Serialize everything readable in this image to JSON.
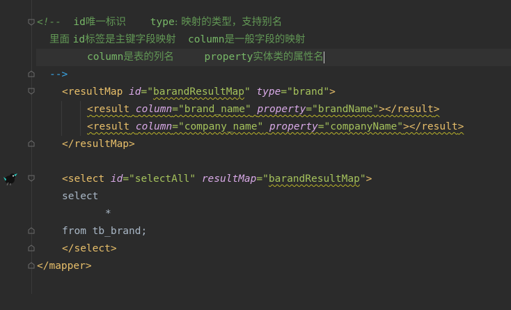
{
  "editor": {
    "lines": [
      {
        "parts": [
          "<!--",
          "id",
          "唯一标识",
          "type",
          ": ",
          "映射的类型，支持别名"
        ]
      },
      {
        "parts": [
          "里面 ",
          "id",
          "标签是主键字段映射",
          "column",
          "是一般字段的映射"
        ]
      },
      {
        "parts": [
          "column",
          "是表的列名",
          "property",
          "实体类的属性名"
        ]
      },
      {
        "parts": [
          "-->"
        ]
      },
      {
        "parts": [
          "<",
          "resultMap",
          "id",
          "=",
          "\"",
          "barandResultMap",
          "\"",
          "type",
          "=\"brand\"",
          ">"
        ]
      },
      {
        "parts": [
          "<",
          "result",
          "column",
          "=\"brand_name\"",
          "property",
          "=\"brandName\"",
          "></",
          "result",
          ">"
        ]
      },
      {
        "parts": [
          "<",
          "result",
          "column",
          "=\"company_name\"",
          "property",
          "=\"companyName\"",
          "></",
          "result",
          ">"
        ]
      },
      {
        "parts": [
          "</",
          "resultMap",
          ">"
        ]
      },
      {
        "parts": [
          "<",
          "select",
          "id",
          "=\"selectAll\"",
          "resultMap",
          "=\"",
          "barandResultMap",
          "\"",
          ">"
        ]
      },
      {
        "parts": [
          "select"
        ]
      },
      {
        "parts": [
          "*"
        ]
      },
      {
        "parts": [
          "from tb_brand;"
        ]
      },
      {
        "parts": [
          "</",
          "select",
          ">"
        ]
      },
      {
        "parts": [
          "</",
          "mapper",
          ">"
        ]
      }
    ]
  },
  "colors": {
    "background": "#2b2b2b",
    "current_line": "#323232",
    "tag": "#e8bf6a",
    "attribute": "#bababa",
    "attribute_italic": "#d8a9e6",
    "string": "#a5c25c",
    "comment": "#629755",
    "plain": "#a9b7c6"
  },
  "icons": {
    "gutter_fold": "fold-marker-icon",
    "mybatis": "mybatis-bird-icon"
  }
}
